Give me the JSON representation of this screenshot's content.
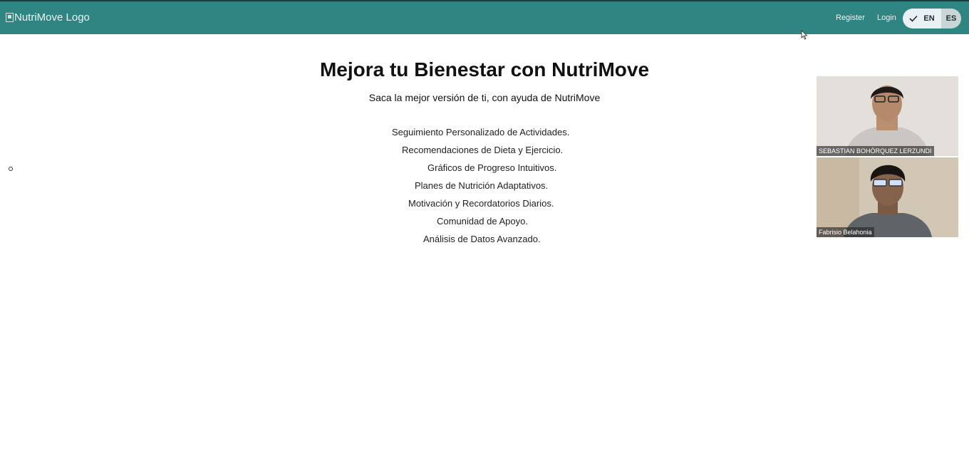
{
  "header": {
    "logo_alt": "NutriMove Logo",
    "register_label": "Register",
    "login_label": "Login",
    "language": {
      "options": [
        "EN",
        "ES"
      ],
      "selected": "EN"
    }
  },
  "hero": {
    "title": "Mejora tu Bienestar con NutriMove",
    "subtitle": "Saca la mejor versión de ti, con ayuda de NutriMove"
  },
  "features": [
    "Seguimiento Personalizado de Actividades.",
    "Recomendaciones de Dieta y Ejercicio.",
    "Gráficos de Progreso Intuitivos.",
    "Planes de Nutrición Adaptativos.",
    "Motivación y Recordatorios Diarios.",
    "Comunidad de Apoyo.",
    "Análisis de Datos Avanzado."
  ],
  "video_call": {
    "participants": [
      {
        "name": "SEBASTIAN BOHÓRQUEZ LERZUNDI"
      },
      {
        "name": "Fabrisio Belahonia"
      }
    ]
  },
  "colors": {
    "navbar": "#2e8582",
    "toggle_selected": "#e9f1f4",
    "toggle_unselected": "#c9d6d6"
  }
}
